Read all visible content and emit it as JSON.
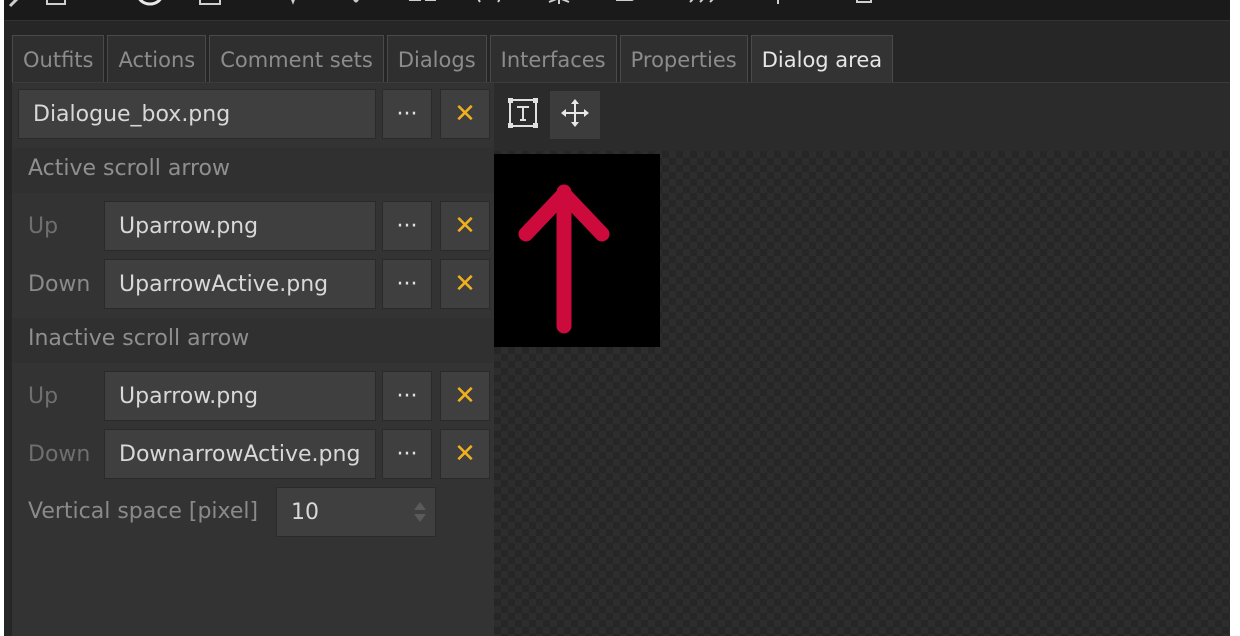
{
  "toolbar": {
    "icons": [
      "eyedropper-icon",
      "square-icon",
      "circle-icon",
      "image-icon",
      "pin-icon",
      "scissors-icon",
      "network-icon",
      "brackets-icon",
      "burst-icon",
      "chat-icon",
      "fast-forward-icon",
      "plus-icon",
      "lock-icon"
    ]
  },
  "tabs": [
    {
      "label": "Outfits",
      "active": false
    },
    {
      "label": "Actions",
      "active": false
    },
    {
      "label": "Comment sets",
      "active": false
    },
    {
      "label": "Dialogs",
      "active": false
    },
    {
      "label": "Interfaces",
      "active": false
    },
    {
      "label": "Properties",
      "active": false
    },
    {
      "label": "Dialog area",
      "active": true
    }
  ],
  "panel": {
    "image_file": "Dialogue_box.png",
    "browse_label": "···",
    "clear_label": "✕",
    "active_scroll_arrow": {
      "heading": "Active scroll arrow",
      "up_label": "Up",
      "up_value": "Uparrow.png",
      "down_label": "Down",
      "down_value": "UparrowActive.png"
    },
    "inactive_scroll_arrow": {
      "heading": "Inactive scroll arrow",
      "up_label": "Up",
      "up_value": "Uparrow.png",
      "down_label": "Down",
      "down_value": "DownarrowActive.png"
    },
    "vertical_space": {
      "label": "Vertical space [pixel]",
      "value": "10"
    }
  },
  "canvas": {
    "tools": [
      "text-tool-icon",
      "move-tool-icon"
    ],
    "preview_arrow_color": "#cc0a3c"
  }
}
